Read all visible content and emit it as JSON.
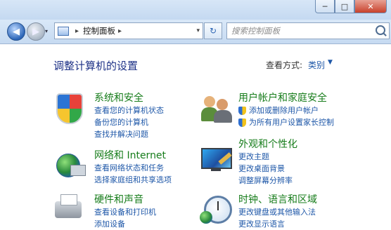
{
  "window": {
    "controls": [
      "─",
      "□",
      "✕"
    ]
  },
  "nav": {
    "back_glyph": "◀",
    "forward_glyph": "▶",
    "history_glyph": "▾",
    "address_crumb": "控制面板",
    "address_separator": "▸",
    "address_dropdown": "▾",
    "refresh_glyph": "↻",
    "search_placeholder": "搜索控制面板"
  },
  "content": {
    "heading": "调整计算机的设置",
    "view_by_label": "查看方式:",
    "view_by_value": "类别",
    "view_by_arrow": "▼"
  },
  "categories": [
    {
      "icon": "security-shield-icon",
      "title": "系统和安全",
      "links": [
        "查看您的计算机状态",
        "备份您的计算机",
        "查找并解决问题"
      ]
    },
    {
      "icon": "network-globe-icon",
      "title": "网络和 Internet",
      "links": [
        "查看网络状态和任务",
        "选择家庭组和共享选项"
      ]
    },
    {
      "icon": "printer-icon",
      "title": "硬件和声音",
      "links": [
        "查看设备和打印机",
        "添加设备"
      ]
    },
    {
      "icon": "users-icon",
      "title": "用户帐户和家庭安全",
      "links": [
        "添加或删除用户帐户",
        "为所有用户设置家长控制"
      ]
    },
    {
      "icon": "display-brush-icon",
      "title": "外观和个性化",
      "links": [
        "更改主题",
        "更改桌面背景",
        "调整屏幕分辨率"
      ]
    },
    {
      "icon": "clock-globe-icon",
      "title": "时钟、语言和区域",
      "links": [
        "更改键盘或其他输入法",
        "更改显示语言"
      ]
    }
  ]
}
